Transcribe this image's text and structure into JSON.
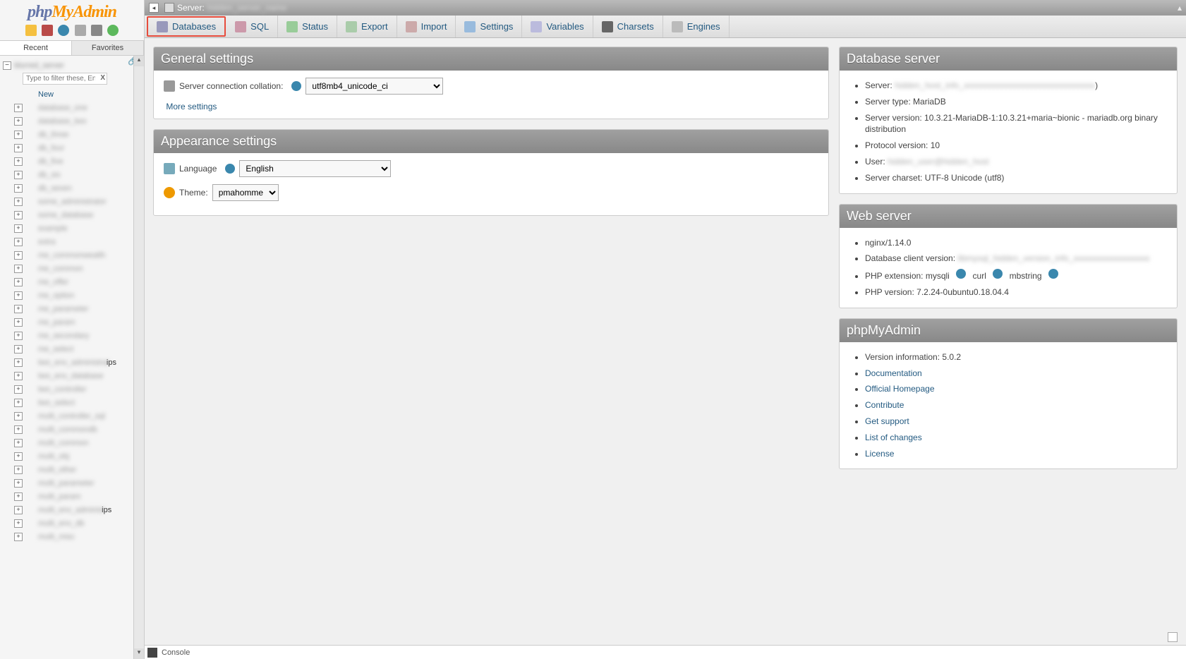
{
  "logo": {
    "part1": "php",
    "part2": "MyAdmin"
  },
  "sidebar": {
    "nav_recent": "Recent",
    "nav_fav": "Favorites",
    "filter_placeholder": "Type to filter these, Enter to",
    "root_label": "blurred_server",
    "dbs": [
      {
        "name": "New",
        "new": true
      },
      {
        "name": "database_one"
      },
      {
        "name": "database_two"
      },
      {
        "name": "db_three"
      },
      {
        "name": "db_four"
      },
      {
        "name": "db_five"
      },
      {
        "name": "db_six"
      },
      {
        "name": "db_seven"
      },
      {
        "name": "some_administrator"
      },
      {
        "name": "some_database"
      },
      {
        "name": "example"
      },
      {
        "name": "extra"
      },
      {
        "name": "me_commonwealth"
      },
      {
        "name": "me_common"
      },
      {
        "name": "me_offer"
      },
      {
        "name": "me_option"
      },
      {
        "name": "me_parameter"
      },
      {
        "name": "me_param"
      },
      {
        "name": "me_secondary"
      },
      {
        "name": "me_select"
      },
      {
        "name": "two_env_administrat",
        "suffix": "ips"
      },
      {
        "name": "two_env_database"
      },
      {
        "name": "two_controller"
      },
      {
        "name": "two_select"
      },
      {
        "name": "multi_controller_sql"
      },
      {
        "name": "multi_commondb"
      },
      {
        "name": "multi_common"
      },
      {
        "name": "multi_obj"
      },
      {
        "name": "multi_other"
      },
      {
        "name": "multi_parameter"
      },
      {
        "name": "multi_param"
      },
      {
        "name": "multi_env_administ",
        "suffix": "ips"
      },
      {
        "name": "multi_env_db"
      },
      {
        "name": "multi_misc"
      }
    ]
  },
  "topbar": {
    "server_label": "Server:",
    "server_value": "hidden_server_name"
  },
  "tabs": [
    {
      "icon": "i-db",
      "label": "Databases",
      "hl": true
    },
    {
      "icon": "i-sql",
      "label": "SQL"
    },
    {
      "icon": "i-status",
      "label": "Status"
    },
    {
      "icon": "i-export",
      "label": "Export"
    },
    {
      "icon": "i-import",
      "label": "Import"
    },
    {
      "icon": "i-settings",
      "label": "Settings"
    },
    {
      "icon": "i-vars",
      "label": "Variables"
    },
    {
      "icon": "i-char",
      "label": "Charsets"
    },
    {
      "icon": "i-eng",
      "label": "Engines"
    }
  ],
  "general": {
    "title": "General settings",
    "collation_label": "Server connection collation:",
    "collation_value": "utf8mb4_unicode_ci",
    "more": "More settings"
  },
  "appearance": {
    "title": "Appearance settings",
    "language_label": "Language",
    "language_value": "English",
    "theme_label": "Theme:",
    "theme_value": "pmahomme"
  },
  "dbserver": {
    "title": "Database server",
    "items": [
      {
        "k": "Server:",
        "blur": "hidden_host_info_xxxxxxxxxxxxxxxxxxxxxxxxxxxxxxx",
        "suf": ")"
      },
      {
        "k": "Server type:",
        "v": "MariaDB"
      },
      {
        "k": "Server version:",
        "v": "10.3.21-MariaDB-1:10.3.21+maria~bionic - mariadb.org binary distribution"
      },
      {
        "k": "Protocol version:",
        "v": "10"
      },
      {
        "k": "User:",
        "blur": "hidden_user@hidden_host"
      },
      {
        "k": "Server charset:",
        "v": "UTF-8 Unicode (utf8)"
      }
    ]
  },
  "webserver": {
    "title": "Web server",
    "nginx": "nginx/1.14.0",
    "dbclient_k": "Database client version:",
    "dbclient_blur": "libmysql_hidden_version_info_xxxxxxxxxxxxxxxxxx",
    "phpext_k": "PHP extension:",
    "ext1": "mysqli",
    "ext2": "curl",
    "ext3": "mbstring",
    "phpver_k": "PHP version:",
    "phpver_v": "7.2.24-0ubuntu0.18.04.4"
  },
  "pma": {
    "title": "phpMyAdmin",
    "version_k": "Version information:",
    "version_v": "5.0.2",
    "links": [
      "Documentation",
      "Official Homepage",
      "Contribute",
      "Get support",
      "List of changes",
      "License"
    ]
  },
  "console": "Console"
}
